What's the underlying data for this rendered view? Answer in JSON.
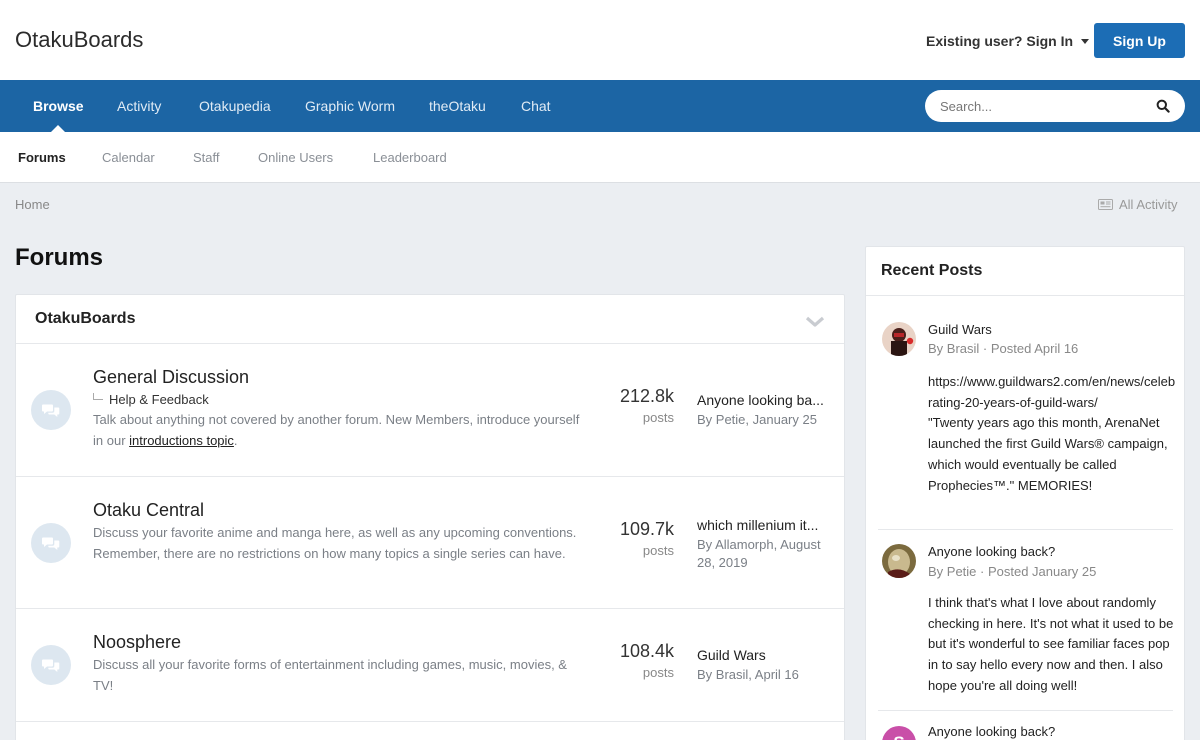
{
  "header": {
    "logo": "OtakuBoards",
    "signin_label": "Existing user? Sign In",
    "signup_label": "Sign Up"
  },
  "nav": {
    "items": [
      {
        "label": "Browse",
        "active": true
      },
      {
        "label": "Activity"
      },
      {
        "label": "Otakupedia"
      },
      {
        "label": "Graphic Worm"
      },
      {
        "label": "theOtaku"
      },
      {
        "label": "Chat"
      }
    ],
    "search_placeholder": "Search..."
  },
  "subnav": {
    "items": [
      {
        "label": "Forums",
        "active": true
      },
      {
        "label": "Calendar"
      },
      {
        "label": "Staff"
      },
      {
        "label": "Online Users"
      },
      {
        "label": "Leaderboard"
      }
    ]
  },
  "breadcrumb": {
    "home": "Home",
    "all_activity": "All Activity"
  },
  "page": {
    "title": "Forums"
  },
  "category": {
    "title": "OtakuBoards",
    "forums": [
      {
        "title": "General Discussion",
        "subforum": "Help & Feedback",
        "desc_before": "Talk about anything not covered by another forum. New Members, introduce yourself in our ",
        "desc_link": "introductions topic",
        "desc_after": ".",
        "count": "212.8k",
        "count_label": "posts",
        "last_title": "Anyone looking ba...",
        "last_by": "By Petie, January 25"
      },
      {
        "title": "Otaku Central",
        "desc": "Discuss your favorite anime and manga here, as well as any upcoming conventions. Remember, there are no restrictions on how many topics a single series can have.",
        "count": "109.7k",
        "count_label": "posts",
        "last_title": "which millenium it...",
        "last_by": "By Allamorph, August 28, 2019"
      },
      {
        "title": "Noosphere",
        "desc": "Discuss all your favorite forms of entertainment including games, music, movies, & TV!",
        "count": "108.4k",
        "count_label": "posts",
        "last_title": "Guild Wars",
        "last_by": "By Brasil, April 16"
      }
    ]
  },
  "recent": {
    "title": "Recent Posts",
    "posts": [
      {
        "title": "Guild Wars",
        "meta": "By Brasil · Posted April 16",
        "body": "https://www.guildwars2.com/en/news/celebrating-20-years-of-guild-wars/",
        "body2": "\"Twenty years ago this month, ArenaNet launched the first Guild Wars® campaign, which would eventually be called Prophecies™.\" MEMORIES!"
      },
      {
        "title": "Anyone looking back?",
        "meta": "By Petie · Posted January 25",
        "body": "I think that's what I love about randomly checking in here. It's not what it used to be but it's wonderful to see familiar faces pop in to say hello every now and then. I also hope you're all doing well!"
      },
      {
        "title": "Anyone looking back?",
        "avatar_letter": "S"
      }
    ]
  },
  "colors": {
    "primary": "#1c6db5",
    "navbar": "#1c65a4",
    "background": "#ebeef2",
    "avatar_s": "#c94fa8"
  }
}
